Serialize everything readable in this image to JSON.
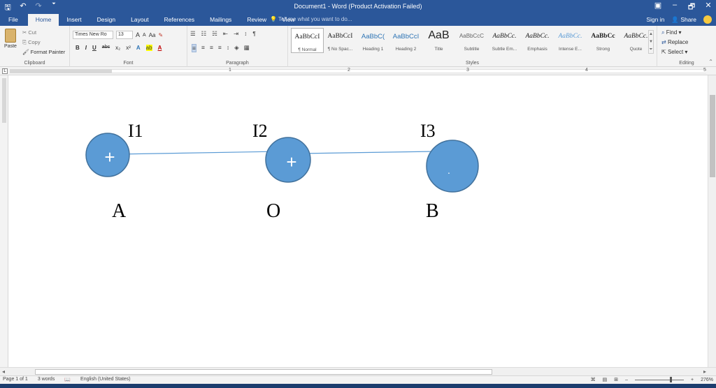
{
  "window": {
    "title": "Document1 - Word (Product Activation Failed)",
    "controls": [
      "▣",
      "–",
      "🗗",
      "✕"
    ]
  },
  "qat": {
    "save": "🖫",
    "undo": "↶",
    "redo": "↷",
    "customize": "⏷"
  },
  "tabs": [
    "File",
    "Home",
    "Insert",
    "Design",
    "Layout",
    "References",
    "Mailings",
    "Review",
    "View"
  ],
  "tell_me": "Tell me what you want to do...",
  "account": {
    "sign_in": "Sign in",
    "share": "Share"
  },
  "clipboard": {
    "paste": "Paste",
    "cut": "Cut",
    "copy": "Copy",
    "format_painter": "Format Painter",
    "label": "Clipboard"
  },
  "font": {
    "name": "Times New Ro",
    "size": "13",
    "grow": "A",
    "shrink": "A",
    "case": "Aa",
    "clear": "✎",
    "bold": "B",
    "italic": "I",
    "underline": "U",
    "strike": "abc",
    "subscript": "x₂",
    "superscript": "x²",
    "effects": "A",
    "highlight": "ab",
    "color": "A",
    "label": "Font"
  },
  "paragraph": {
    "bullets": "☰",
    "numbering": "☷",
    "multilevel": "☵",
    "decrease_indent": "⇤",
    "increase_indent": "⇥",
    "sort": "↕",
    "show_marks": "¶",
    "align_left": "≡",
    "center": "≡",
    "align_right": "≡",
    "justify": "≡",
    "line_spacing": "↕",
    "shading": "◈",
    "borders": "▦",
    "label": "Paragraph"
  },
  "styles": {
    "items": [
      {
        "sample": "AaBbCcI",
        "name": "¶ Normal",
        "cls": ""
      },
      {
        "sample": "AaBbCcI",
        "name": "¶ No Spac...",
        "cls": ""
      },
      {
        "sample": "AaBbC(",
        "name": "Heading 1",
        "cls": "heading"
      },
      {
        "sample": "AaBbCcI",
        "name": "Heading 2",
        "cls": "heading"
      },
      {
        "sample": "AaB",
        "name": "Title",
        "cls": "title"
      },
      {
        "sample": "AaBbCcC",
        "name": "Subtitle",
        "cls": "subtle"
      },
      {
        "sample": "AaBbCc.",
        "name": "Subtle Em...",
        "cls": "italic"
      },
      {
        "sample": "AaBbCc.",
        "name": "Emphasis",
        "cls": "italic"
      },
      {
        "sample": "AaBbCc.",
        "name": "Intense E...",
        "cls": "blueit"
      },
      {
        "sample": "AaBbCc",
        "name": "Strong",
        "cls": "bold"
      },
      {
        "sample": "AaBbCc.",
        "name": "Quote",
        "cls": "italic"
      }
    ],
    "label": "Styles"
  },
  "editing": {
    "find": "Find",
    "replace": "Replace",
    "select": "Select",
    "label": "Editing"
  },
  "ruler": {
    "numbers": [
      "1",
      "2",
      "3",
      "4",
      "5"
    ]
  },
  "document": {
    "nodes": [
      {
        "label": "A",
        "current": "I1",
        "mark": "+"
      },
      {
        "label": "O",
        "current": "I2",
        "mark": "+"
      },
      {
        "label": "B",
        "current": "I3",
        "mark": "·"
      }
    ],
    "node_fill": "#5b9bd5",
    "node_stroke": "#41719c",
    "wire_color": "#5b9bd5"
  },
  "status": {
    "page": "Page 1 of 1",
    "words": "3 words",
    "language": "English (United States)",
    "zoom": "276%",
    "zoom_minus": "–",
    "zoom_plus": "+"
  },
  "colors": {
    "accent": "#2b579a",
    "ribbon_bg": "#f3f3f3"
  }
}
